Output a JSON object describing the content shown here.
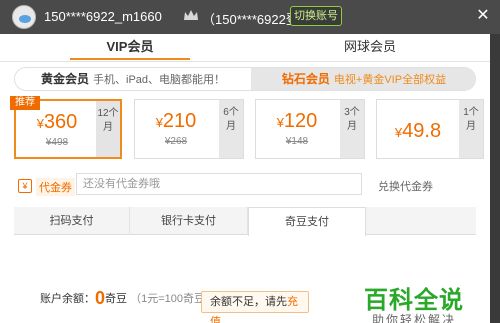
{
  "header": {
    "username": "150****6922_m1660",
    "login_info": "（150****6922登录）",
    "switch_account": "切换账号",
    "close": "✕"
  },
  "tabs": [
    {
      "label": "VIP会员",
      "active": true
    },
    {
      "label": "网球会员",
      "active": false
    }
  ],
  "levels": {
    "gold": {
      "title": "黄金会员",
      "desc": "手机、iPad、电脑都能用！"
    },
    "diamond": {
      "title": "钻石会员",
      "desc": "电视+黄金VIP全部权益"
    }
  },
  "cards": [
    {
      "price": "360",
      "old": "¥498",
      "duration": "12个月",
      "badge": "推荐",
      "selected": true
    },
    {
      "price": "210",
      "old": "¥268",
      "duration": "6个月",
      "selected": false
    },
    {
      "price": "120",
      "old": "¥148",
      "duration": "3个月",
      "selected": false
    },
    {
      "price": "49.8",
      "old": "",
      "duration": "1个月",
      "selected": false
    }
  ],
  "currency": "¥",
  "voucher": {
    "label": "代金券",
    "placeholder": "还没有代金券哦",
    "exchange": "兑换代金券"
  },
  "pay_tabs": [
    {
      "label": "扫码支付",
      "active": false
    },
    {
      "label": "银行卡支付",
      "active": false
    },
    {
      "label": "奇豆支付",
      "active": true
    }
  ],
  "balance": {
    "label": "账户余额：",
    "amount": "0",
    "unit": "奇豆",
    "rate": "（1元=100奇豆）",
    "warning": "余额不足，请先",
    "recharge": "充值"
  },
  "watermark": {
    "main": "百科全说",
    "sub": "助你轻松解决"
  },
  "colors": {
    "accent": "#f06c00",
    "header_bg": "#4a4a4a",
    "switch_border": "#8fce3b",
    "watermark": "#29a829"
  }
}
